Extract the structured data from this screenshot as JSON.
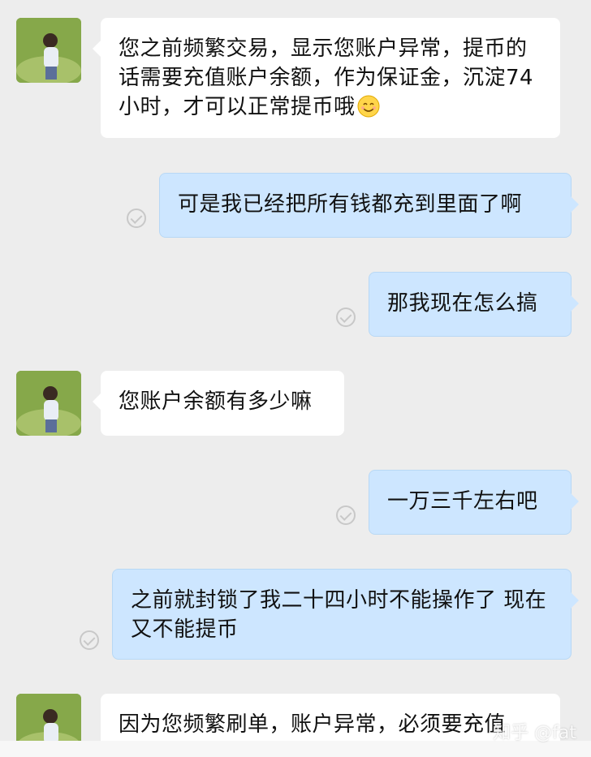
{
  "messages": [
    {
      "side": "left",
      "text": "您之前频繁交易，显示您账户异常，提币的话需要充值账户余额，作为保证金，沉淀74小时，才可以正常提币哦",
      "emoji": "smiling-face-icon"
    },
    {
      "side": "right",
      "text": "可是我已经把所有钱都充到里面了啊"
    },
    {
      "side": "right",
      "text": "那我现在怎么搞"
    },
    {
      "side": "left",
      "text": "您账户余额有多少嘛"
    },
    {
      "side": "right",
      "text": "一万三千左右吧"
    },
    {
      "side": "right",
      "text": "之前就封锁了我二十四小时不能操作了 现在又不能提币"
    },
    {
      "side": "left",
      "text": "因为您频繁刷单，账户异常，必须要充值"
    }
  ],
  "watermark": "知乎 @fat",
  "colors": {
    "background": "#ededed",
    "left_bubble": "#ffffff",
    "right_bubble": "#cde6ff",
    "read_check": "#c8c8c8"
  }
}
